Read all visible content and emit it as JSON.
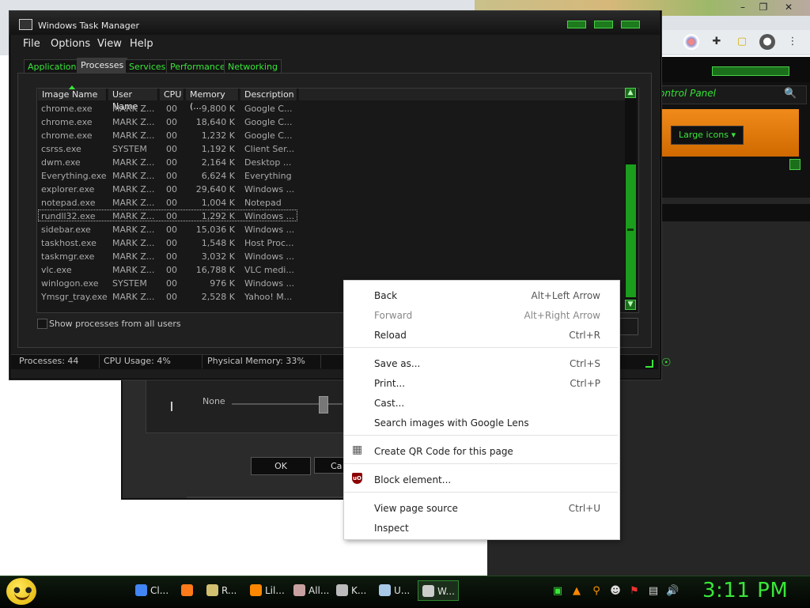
{
  "task_manager": {
    "title": "Windows Task Manager",
    "menu": [
      "File",
      "Options",
      "View",
      "Help"
    ],
    "tabs": [
      {
        "label": "Applications",
        "active": false
      },
      {
        "label": "Processes",
        "active": true
      },
      {
        "label": "Services",
        "active": false
      },
      {
        "label": "Performance",
        "active": false
      },
      {
        "label": "Networking",
        "active": false
      }
    ],
    "columns": [
      "Image Name",
      "User Name",
      "CPU",
      "Memory (...",
      "Description"
    ],
    "rows": [
      [
        "chrome.exe",
        "MARK Z...",
        "00",
        "9,800 K",
        "Google C..."
      ],
      [
        "chrome.exe",
        "MARK Z...",
        "00",
        "18,640 K",
        "Google C..."
      ],
      [
        "chrome.exe",
        "MARK Z...",
        "00",
        "1,232 K",
        "Google C..."
      ],
      [
        "csrss.exe",
        "SYSTEM",
        "00",
        "1,192 K",
        "Client Ser..."
      ],
      [
        "dwm.exe",
        "MARK Z...",
        "00",
        "2,164 K",
        "Desktop ..."
      ],
      [
        "Everything.exe",
        "MARK Z...",
        "00",
        "6,624 K",
        "Everything"
      ],
      [
        "explorer.exe",
        "MARK Z...",
        "00",
        "29,640 K",
        "Windows ..."
      ],
      [
        "notepad.exe",
        "MARK Z...",
        "00",
        "1,004 K",
        "Notepad"
      ],
      [
        "rundll32.exe",
        "MARK Z...",
        "00",
        "1,292 K",
        "Windows ..."
      ],
      [
        "sidebar.exe",
        "MARK Z...",
        "00",
        "15,036 K",
        "Windows ..."
      ],
      [
        "taskhost.exe",
        "MARK Z...",
        "00",
        "1,548 K",
        "Host Proc..."
      ],
      [
        "taskmgr.exe",
        "MARK Z...",
        "00",
        "3,032 K",
        "Windows ..."
      ],
      [
        "vlc.exe",
        "MARK Z...",
        "00",
        "16,788 K",
        "VLC medi..."
      ],
      [
        "winlogon.exe",
        "SYSTEM",
        "00",
        "976 K",
        "Windows ..."
      ],
      [
        "Ymsgr_tray.exe",
        "MARK Z...",
        "00",
        "2,528 K",
        "Yahoo! M..."
      ]
    ],
    "show_all_label": "Show processes from all users",
    "status": {
      "processes": "Processes: 44",
      "cpu": "CPU Usage: 4%",
      "memory": "Physical Memory: 33%"
    }
  },
  "control_panel": {
    "address_text": "ontrol Panel",
    "view_button": "Large icons ▾"
  },
  "dialog": {
    "slider_label": "None",
    "ok": "OK",
    "cancel": "Ca"
  },
  "context_menu": {
    "items": [
      {
        "label": "Back",
        "shortcut": "Alt+Left Arrow",
        "disabled": false
      },
      {
        "label": "Forward",
        "shortcut": "Alt+Right Arrow",
        "disabled": true
      },
      {
        "label": "Reload",
        "shortcut": "Ctrl+R",
        "disabled": false
      },
      {
        "label": "Save as...",
        "shortcut": "Ctrl+S",
        "disabled": false
      },
      {
        "label": "Print...",
        "shortcut": "Ctrl+P",
        "disabled": false
      },
      {
        "label": "Cast...",
        "shortcut": "",
        "disabled": false
      },
      {
        "label": "Search images with Google Lens",
        "shortcut": "",
        "disabled": false
      },
      {
        "label": "Create QR Code for this page",
        "shortcut": "",
        "disabled": false
      },
      {
        "label": "Block element...",
        "shortcut": "",
        "disabled": false
      },
      {
        "label": "View page source",
        "shortcut": "Ctrl+U",
        "disabled": false
      },
      {
        "label": "Inspect",
        "shortcut": "",
        "disabled": false
      }
    ]
  },
  "taskbar": {
    "buttons": [
      {
        "label": "Cl...",
        "icon": "chrome-icon",
        "color": "#4285f4"
      },
      {
        "label": "",
        "icon": "firefox-icon",
        "color": "#ff7a1a"
      },
      {
        "label": "R...",
        "icon": "document-icon",
        "color": "#d0c070"
      },
      {
        "label": "Lil...",
        "icon": "vlc-icon",
        "color": "#ff8800"
      },
      {
        "label": "All...",
        "icon": "paint-icon",
        "color": "#c9a0a0"
      },
      {
        "label": "K...",
        "icon": "keyboard-icon",
        "color": "#bbbbbb"
      },
      {
        "label": "U...",
        "icon": "notepad-icon",
        "color": "#a8c8e8"
      },
      {
        "label": "W...",
        "icon": "taskmanager-icon",
        "color": "#cccccc"
      }
    ],
    "clock": "3:11 PM"
  },
  "colors": {
    "accent_green": "#39e639",
    "context_bg": "#ffffff",
    "task_manager_bg": "#1c1c1c"
  }
}
